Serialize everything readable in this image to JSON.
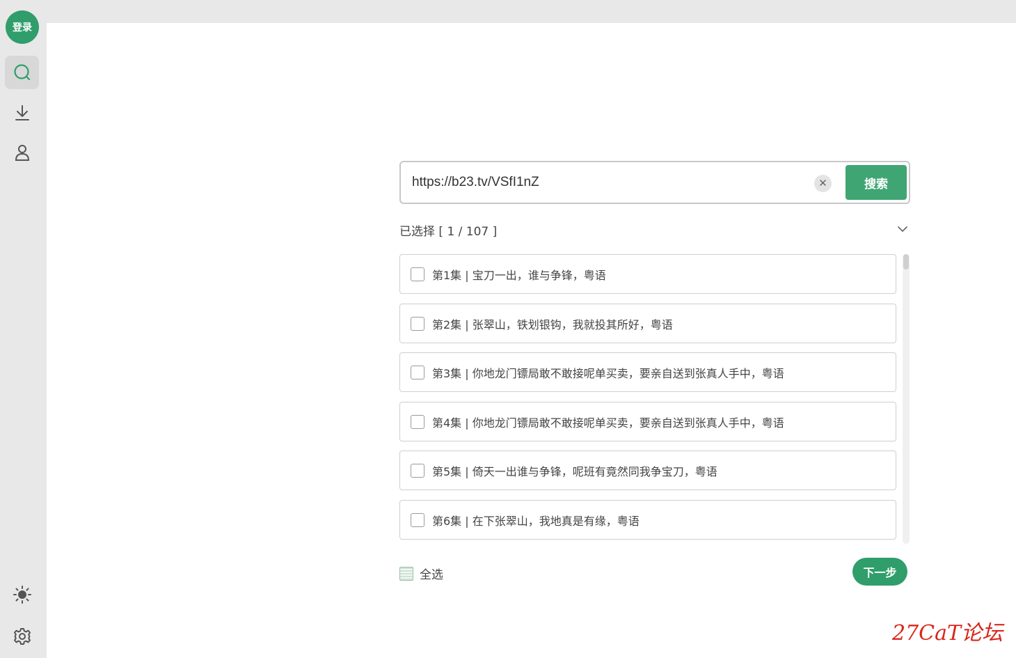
{
  "sidebar": {
    "avatar_label": "登录",
    "nav": [
      {
        "icon": "search-icon",
        "active": true
      },
      {
        "icon": "download-icon",
        "active": false
      },
      {
        "icon": "user-icon",
        "active": false
      }
    ],
    "bottom": [
      {
        "icon": "theme-sun-icon"
      },
      {
        "icon": "gear-icon"
      }
    ]
  },
  "search": {
    "value": "https://b23.tv/VSfI1nZ",
    "clear_label": "✕",
    "button_label": "搜索"
  },
  "selection": {
    "summary": "已选择 [ 1 / 107 ]"
  },
  "episodes": [
    {
      "label": "第1集 | 宝刀一出，谁与争锋，粤语"
    },
    {
      "label": "第2集 | 张翠山，铁划银钩，我就投其所好，粤语"
    },
    {
      "label": "第3集 | 你地龙门镖局敢不敢接呢单买卖，要亲自送到张真人手中，粤语"
    },
    {
      "label": "第4集 | 你地龙门镖局敢不敢接呢单买卖，要亲自送到张真人手中，粤语"
    },
    {
      "label": "第5集 | 倚天一出谁与争锋，呢班有竟然同我争宝刀，粤语"
    },
    {
      "label": "第6集 | 在下张翠山，我地真是有缘，粤语"
    }
  ],
  "footer": {
    "select_all_label": "全选",
    "next_label": "下一步"
  },
  "watermark": "27CaT论坛",
  "colors": {
    "accent": "#2f9e6a",
    "search_button": "#3fa673",
    "watermark": "#d9261c"
  }
}
